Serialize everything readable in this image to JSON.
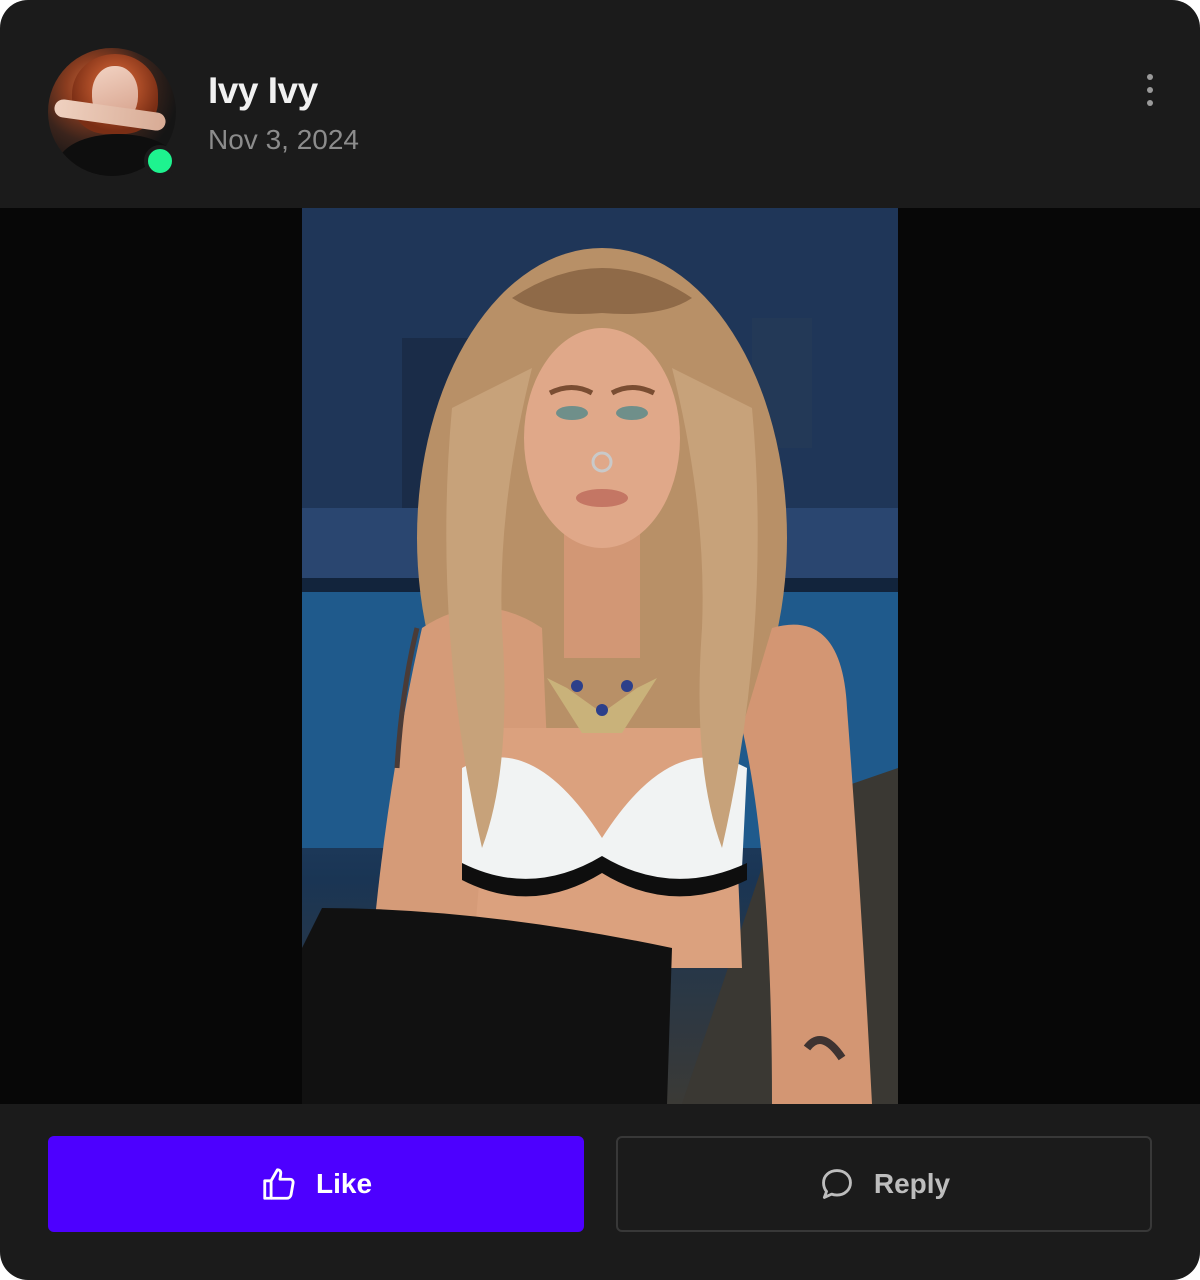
{
  "post": {
    "author_name": "Ivy Ivy",
    "date": "Nov 3, 2024",
    "online": true
  },
  "icons": {
    "more": "more-vertical-icon",
    "like": "thumbs-up-icon",
    "reply": "speech-bubble-icon"
  },
  "actions": {
    "like_label": "Like",
    "reply_label": "Reply"
  },
  "colors": {
    "card_background": "#1b1b1b",
    "online_status": "#1ef38f",
    "like_button": "#4d00ff",
    "reply_border": "#383838"
  }
}
